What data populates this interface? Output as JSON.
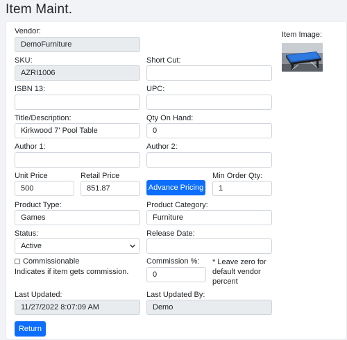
{
  "page": {
    "title": "Item Maint."
  },
  "form": {
    "vendor": {
      "label": "Vendor:",
      "value": "DemoFurniture"
    },
    "sku": {
      "label": "SKU:",
      "value": "AZRI1006"
    },
    "short_cut": {
      "label": "Short Cut:",
      "value": ""
    },
    "isbn13": {
      "label": "ISBN 13:",
      "value": ""
    },
    "upc": {
      "label": "UPC:",
      "value": ""
    },
    "title": {
      "label": "Title/Description:",
      "value": "Kirkwood 7' Pool Table"
    },
    "qty_on_hand": {
      "label": "Qty On Hand:",
      "value": "0"
    },
    "author1": {
      "label": "Author 1:",
      "value": ""
    },
    "author2": {
      "label": "Author 2:",
      "value": ""
    },
    "unit_price": {
      "label": "Unit Price",
      "value": "500"
    },
    "retail_price": {
      "label": "Retail Price",
      "value": "851.87"
    },
    "advance_pricing": {
      "label": "Advance Pricing"
    },
    "min_order_qty": {
      "label": "Min Order Qty:",
      "value": "1"
    },
    "product_type": {
      "label": "Product Type:",
      "value": "Games"
    },
    "product_category": {
      "label": "Product Category:",
      "value": "Furniture"
    },
    "status": {
      "label": "Status:",
      "value": "Active"
    },
    "release_date": {
      "label": "Release Date:",
      "value": ""
    },
    "commissionable": {
      "label": "Commissionable",
      "checked": false,
      "help": "Indicates if item gets commission."
    },
    "commission_pct": {
      "label": "Commission %:",
      "value": "0",
      "note_line1": "* Leave zero for",
      "note_line2": "default vendor",
      "note_line3": "percent"
    },
    "last_updated": {
      "label": "Last Updated:",
      "value": "11/27/2022 8:07:09 AM"
    },
    "last_updated_by": {
      "label": "Last Updated By:",
      "value": "Demo"
    },
    "return_button": {
      "label": "Return"
    }
  },
  "item_image": {
    "label": "Item Image:",
    "icon": "pool-table-photo"
  },
  "colors": {
    "primary": "#0d6efd",
    "readonly_bg": "#e9ecef",
    "border": "#ced4da",
    "page_bg": "#f1f3f6"
  }
}
